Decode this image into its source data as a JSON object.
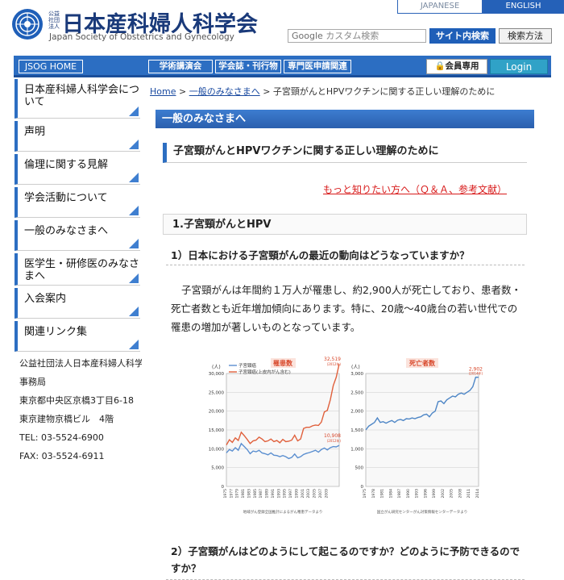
{
  "header": {
    "corp_label": "公益社団法人",
    "org_name_ja": "日本産科婦人科学会",
    "org_name_en": "Japan Society of Obstetrics and Gynecology",
    "lang_ja": "JAPANESE",
    "lang_en": "ENGLISH",
    "search_brand": "Google",
    "search_placeholder": "カスタム検索",
    "site_search": "サイト内検索",
    "search_howto": "検索方法"
  },
  "nav": {
    "home": "JSOG HOME",
    "items": [
      "学術講演会",
      "学会誌・刊行物",
      "専門医申請関連"
    ],
    "members": "会員専用",
    "login": "Login"
  },
  "sidebar": {
    "items": [
      "日本産科婦人科学会について",
      "声明",
      "倫理に関する見解",
      "学会活動について",
      "一般のみなさまへ",
      "医学生・研修医のみなさまへ",
      "入会案内",
      "関連リンク集"
    ],
    "info": [
      "公益社団法人日本産科婦人科学会",
      "事務局",
      "東京都中央区京橋3丁目6-18",
      "東京建物京橋ビル　4階",
      "TEL: 03-5524-6900",
      "FAX: 03-5524-6911"
    ]
  },
  "breadcrumb": {
    "home": "Home",
    "sep": ">",
    "section": "一般のみなさまへ",
    "current": "子宮頸がんとHPVワクチンに関する正しい理解のために"
  },
  "main": {
    "section_header": "一般のみなさまへ",
    "title": "子宮頸がんとHPVワクチンに関する正しい理解のために",
    "more_link": "もっと知りたい方へ（Ｑ＆Ａ、参考文献）",
    "heading1": "1.子宮頸がんとHPV",
    "q1": "1）日本における子宮頸がんの最近の動向はどうなっていますか？",
    "para1": "子宮頸がんは年間約１万人が罹患し、約2,900人が死亡しており、患者数・死亡者数とも近年増加傾向にあります。特に、20歳〜40歳台の若い世代での罹患の増加が著しいものとなっています。",
    "q2": "2）子宮頸がんはどのようにして起こるのですか？どのように予防できるのですか？"
  },
  "chart_data": [
    {
      "type": "line",
      "title": "罹患数",
      "ylabel": "(人)",
      "ylim": [
        0,
        30000
      ],
      "yticks": [
        "0",
        "5,000",
        "10,000",
        "15,000",
        "20,000",
        "25,000",
        "30,000"
      ],
      "x": [
        1975,
        1976,
        1977,
        1978,
        1979,
        1980,
        1981,
        1982,
        1983,
        1984,
        1985,
        1986,
        1987,
        1988,
        1989,
        1990,
        1991,
        1992,
        1993,
        1994,
        1995,
        1996,
        1997,
        1998,
        1999,
        2000,
        2001,
        2002,
        2003,
        2004,
        2005,
        2006,
        2007,
        2008,
        2009,
        2010,
        2011,
        2012,
        2013
      ],
      "xticks": [
        "1975",
        "1977",
        "1979",
        "1981",
        "1983",
        "1985",
        "1987",
        "1989",
        "1991",
        "1993",
        "1995",
        "1997",
        "1999",
        "2001",
        "2003",
        "2005",
        "2007",
        "2009"
      ],
      "series": [
        {
          "name": "子宮頸癌",
          "color": "#5b8fd0",
          "values": [
            8900,
            9800,
            9400,
            10300,
            9600,
            11400,
            10600,
            9800,
            8700,
            9400,
            9200,
            9600,
            8900,
            8700,
            8400,
            8900,
            8300,
            8200,
            7900,
            8200,
            7900,
            7400,
            7700,
            8600,
            7600,
            7900,
            8500,
            8800,
            9000,
            9300,
            9600,
            9100,
            9800,
            10200,
            9700,
            10300,
            10600,
            10500,
            10908
          ]
        },
        {
          "name": "子宮頸癌(上皮内がん含む)",
          "color": "#e0603c",
          "values": [
            11000,
            12400,
            11700,
            12900,
            12200,
            14400,
            13500,
            12500,
            11400,
            12100,
            12300,
            13100,
            12600,
            11900,
            12100,
            12600,
            11900,
            12200,
            11600,
            12500,
            11900,
            12000,
            12300,
            13600,
            12100,
            12600,
            15400,
            15700,
            15700,
            16100,
            16300,
            16200,
            17100,
            19800,
            20200,
            23000,
            26800,
            29000,
            32519
          ]
        }
      ],
      "annotations": [
        "32,519",
        "(2012年)",
        "10,908",
        "(2012年)"
      ],
      "source": "地域がん登録全国推計によるがん罹患データより"
    },
    {
      "type": "line",
      "title": "死亡者数",
      "ylabel": "(人)",
      "ylim": [
        0,
        3000
      ],
      "yticks": [
        "0",
        "500",
        "1,000",
        "1,500",
        "2,000",
        "2,500",
        "3,000"
      ],
      "x": [
        1975,
        1976,
        1977,
        1978,
        1979,
        1980,
        1981,
        1982,
        1983,
        1984,
        1985,
        1986,
        1987,
        1988,
        1989,
        1990,
        1991,
        1992,
        1993,
        1994,
        1995,
        1996,
        1997,
        1998,
        1999,
        2000,
        2001,
        2002,
        2003,
        2004,
        2005,
        2006,
        2007,
        2008,
        2009,
        2010,
        2011,
        2012,
        2013,
        2014
      ],
      "xticks": [
        "1975",
        "1978",
        "1981",
        "1984",
        "1987",
        "1990",
        "1993",
        "1996",
        "1999",
        "2002",
        "2005",
        "2008",
        "2011",
        "2014"
      ],
      "series": [
        {
          "name": "死亡者数",
          "color": "#4e86c6",
          "values": [
            1500,
            1600,
            1650,
            1700,
            1820,
            1700,
            1720,
            1680,
            1720,
            1750,
            1700,
            1760,
            1780,
            1750,
            1800,
            1790,
            1820,
            1800,
            1830,
            1850,
            1900,
            1920,
            1850,
            1950,
            2000,
            2250,
            2270,
            2200,
            2300,
            2350,
            2400,
            2380,
            2450,
            2480,
            2450,
            2500,
            2550,
            2650,
            2902,
            2900
          ]
        }
      ],
      "annotations": [
        "2,902",
        "(2014年)"
      ],
      "source": "国立がん研究センターがん対策情報センターデータより"
    }
  ]
}
